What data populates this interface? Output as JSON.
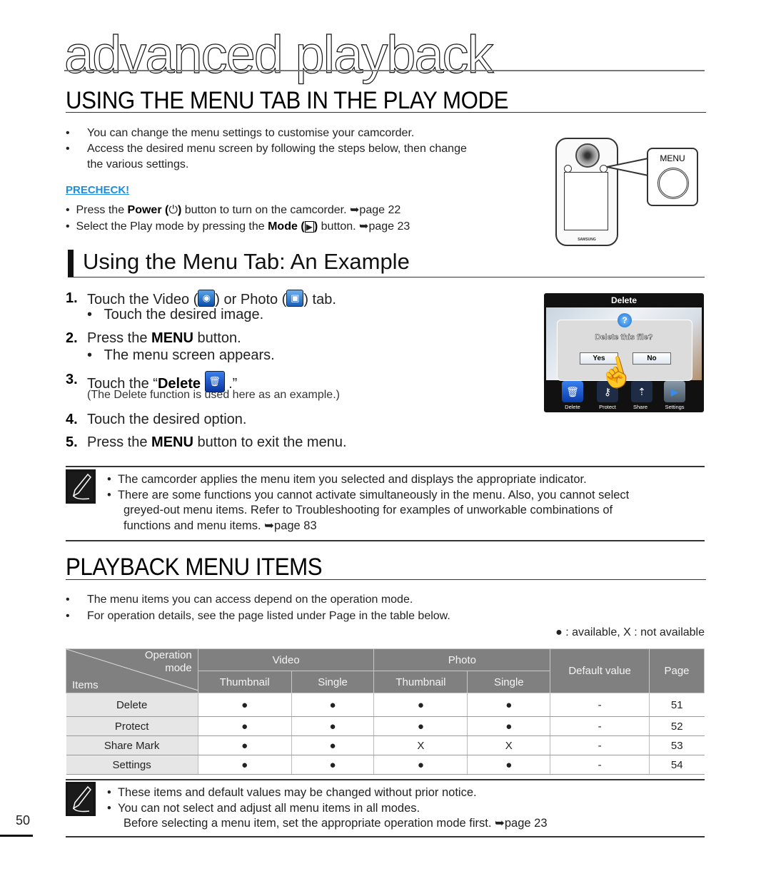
{
  "chapter_title": "advanced playback",
  "section1": {
    "title": "USING THE MENU TAB IN THE PLAY MODE",
    "bullets": [
      "You can change the menu settings to customise your camcorder.",
      "Access the desired menu screen by following the steps below, then change",
      "the various settings."
    ],
    "precheck_label": "PRECHECK!",
    "precheck": [
      {
        "pre": "Press the ",
        "bold": "Power (",
        "icon": "⏻",
        "bold_end": ")",
        "post": " button to turn on the camcorder. ",
        "ref": "➥page 22"
      },
      {
        "pre": "Select the Play mode by pressing the ",
        "bold": "Mode (",
        "icon": "▶",
        "bold_end": ")",
        "post": " button. ",
        "ref": "➥page 23"
      }
    ],
    "camera_illustration": {
      "callout_label": "MENU",
      "brand": "SAMSUNG"
    }
  },
  "section2": {
    "title": "Using the Menu Tab: An Example",
    "steps": [
      {
        "num": "1.",
        "a": "Touch the Video (",
        "b": ") or Photo (",
        "c": ") tab.",
        "sub": "Touch the desired image."
      },
      {
        "num": "2.",
        "a": "Press the ",
        "bold": "MENU",
        "c": " button.",
        "sub": "The menu screen appears."
      },
      {
        "num": "3.",
        "a": "Touch the “",
        "bold": "Delete",
        "c": " .”",
        "note": "(The Delete function is used here as an example.)"
      },
      {
        "num": "4.",
        "a": "Touch the desired option."
      },
      {
        "num": "5.",
        "a": "Press the ",
        "bold": "MENU",
        "c": " button to exit the menu."
      }
    ],
    "screen": {
      "title": "Delete",
      "question": "Delete this file?",
      "yes": "Yes",
      "no": "No",
      "tiles": [
        "Delete",
        "Protect",
        "Share",
        "Settings"
      ]
    }
  },
  "note1": [
    "The camcorder applies the menu item you selected and displays the appropriate indicator.",
    "There are some functions you cannot activate simultaneously in the menu. Also, you cannot select",
    "greyed-out menu items. Refer to Troubleshooting for examples of unworkable combinations of",
    "functions and menu items. ➥page 83"
  ],
  "section3": {
    "title": "PLAYBACK MENU ITEMS",
    "bullets": [
      "The menu items you can access depend on the operation mode.",
      "For operation details, see the page listed under Page in the table below."
    ],
    "legend": "● : available, X : not available",
    "table": {
      "corner_top": "Operation",
      "corner_mid": "mode",
      "corner_bottom": "Items",
      "groups": [
        "Video",
        "Photo"
      ],
      "subheaders": [
        "Thumbnail",
        "Single",
        "Thumbnail",
        "Single"
      ],
      "default_header": "Default value",
      "page_header": "Page",
      "rows": [
        {
          "item": "Delete",
          "vals": [
            "●",
            "●",
            "●",
            "●"
          ],
          "default": "-",
          "page": "51"
        },
        {
          "item": "Protect",
          "vals": [
            "●",
            "●",
            "●",
            "●"
          ],
          "default": "-",
          "page": "52"
        },
        {
          "item": "Share Mark",
          "vals": [
            "●",
            "●",
            "X",
            "X"
          ],
          "default": "-",
          "page": "53"
        },
        {
          "item": "Settings",
          "vals": [
            "●",
            "●",
            "●",
            "●"
          ],
          "default": "-",
          "page": "54"
        }
      ]
    }
  },
  "note2": [
    "These items and default values may be changed without prior notice.",
    "You can not select and adjust all menu items in all modes.",
    "Before selecting a menu item, set the appropriate operation mode first. ➥page 23"
  ],
  "page_number": "50"
}
